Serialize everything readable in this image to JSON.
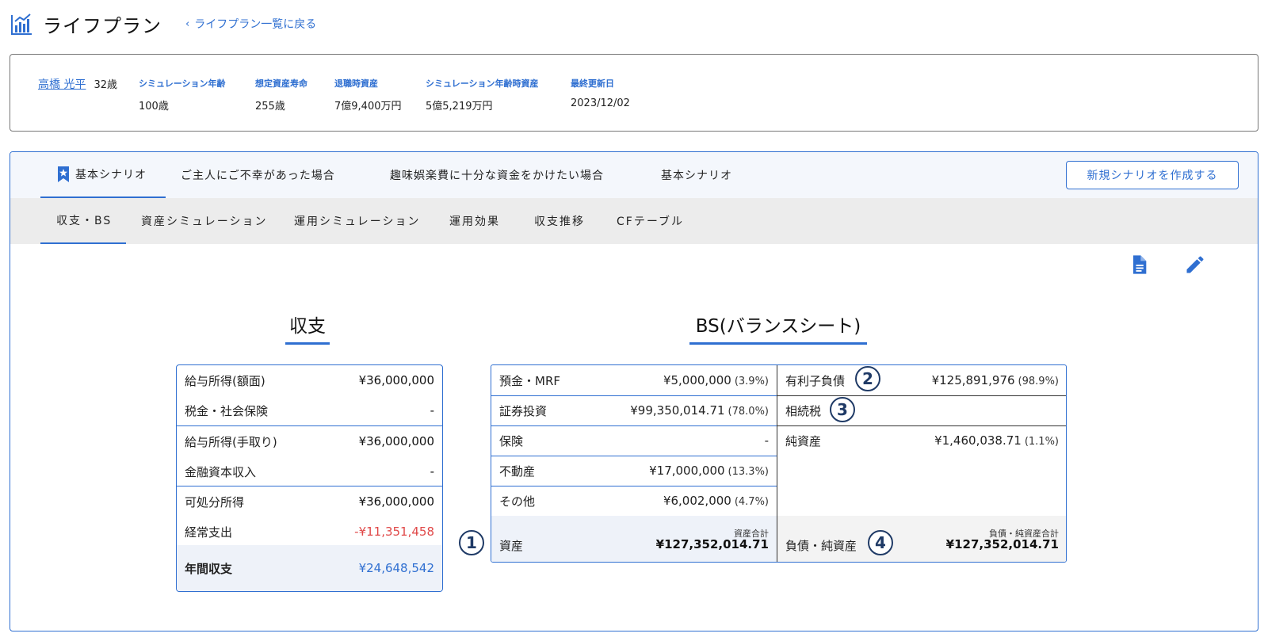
{
  "header": {
    "title": "ライフプラン",
    "back_link": "ライフプラン一覧に戻る"
  },
  "summary": {
    "person_name": "高橋 光平",
    "person_age": "32歳",
    "stats": [
      {
        "label": "シミュレーション年齢",
        "value": "100歳"
      },
      {
        "label": "想定資産寿命",
        "value": "255歳"
      },
      {
        "label": "退職時資産",
        "value": "7億9,400万円"
      },
      {
        "label": "シミュレーション年齢時資産",
        "value": "5億5,219万円"
      },
      {
        "label": "最終更新日",
        "value": "2023/12/02"
      }
    ]
  },
  "scenario_tabs": [
    {
      "label": "基本シナリオ",
      "active": true
    },
    {
      "label": "ご主人にご不幸があった場合",
      "active": false
    },
    {
      "label": "趣味娯楽費に十分な資金をかけたい場合",
      "active": false
    },
    {
      "label": "基本シナリオ",
      "active": false
    }
  ],
  "new_scenario_button": "新規シナリオを作成する",
  "sub_tabs": [
    {
      "label": "収支・BS",
      "active": true
    },
    {
      "label": "資産シミュレーション",
      "active": false
    },
    {
      "label": "運用シミュレーション",
      "active": false
    },
    {
      "label": "運用効果",
      "active": false
    },
    {
      "label": "収支推移",
      "active": false
    },
    {
      "label": "CFテーブル",
      "active": false
    }
  ],
  "toolbar_icons": [
    "document-icon",
    "edit-pencil-icon"
  ],
  "cashflow": {
    "title": "収支",
    "rows": [
      {
        "label": "給与所得(額面)",
        "value": "¥36,000,000"
      },
      {
        "label": "税金・社会保険",
        "value": "-"
      },
      {
        "label": "給与所得(手取り)",
        "value": "¥36,000,000"
      },
      {
        "label": "金融資本収入",
        "value": "-"
      },
      {
        "label": "可処分所得",
        "value": "¥36,000,000"
      },
      {
        "label": "経常支出",
        "value": "-¥11,351,458"
      }
    ],
    "total": {
      "label": "年間収支",
      "value": "¥24,648,542"
    }
  },
  "balance_sheet": {
    "title": "BS(バランスシート)",
    "assets": [
      {
        "label": "預金・MRF",
        "value": "¥5,000,000",
        "pct": "(3.9%)"
      },
      {
        "label": "証券投資",
        "value": "¥99,350,014.71",
        "pct": "(78.0%)"
      },
      {
        "label": "保険",
        "value": "-",
        "pct": ""
      },
      {
        "label": "不動産",
        "value": "¥17,000,000",
        "pct": "(13.3%)"
      },
      {
        "label": "その他",
        "value": "¥6,002,000",
        "pct": "(4.7%)"
      }
    ],
    "liabilities": [
      {
        "label": "有利子負債",
        "value": "¥125,891,976",
        "pct": "(98.9%)",
        "marker": "2"
      },
      {
        "label": "相続税",
        "value": "",
        "pct": "",
        "marker": "3"
      },
      {
        "label": "純資産",
        "value": "¥1,460,038.71",
        "pct": "(1.1%)"
      }
    ],
    "assets_total": {
      "label": "資産",
      "caption": "資産合計",
      "value": "¥127,352,014.71",
      "marker": "1"
    },
    "liabilities_total": {
      "label": "負債・純資産",
      "caption": "負債・純資産合計",
      "value": "¥127,352,014.71",
      "marker": "4"
    }
  },
  "colors": {
    "accent": "#2f6fd1",
    "negative": "#e04848",
    "marker": "#1f3a66"
  }
}
